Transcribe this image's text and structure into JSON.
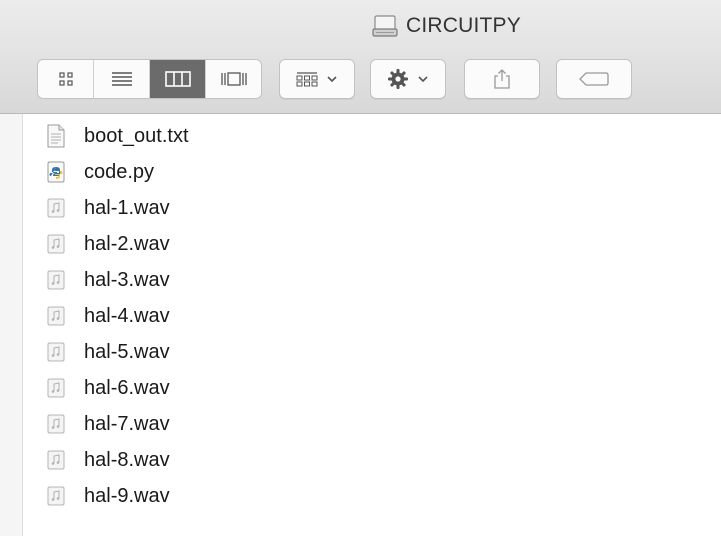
{
  "window": {
    "title": "CIRCUITPY",
    "title_icon": "drive-icon"
  },
  "toolbar": {
    "view_modes": [
      {
        "name": "icon-view",
        "icon": "grid-icon",
        "active": false
      },
      {
        "name": "list-view",
        "icon": "list-icon",
        "active": false
      },
      {
        "name": "column-view",
        "icon": "columns-icon",
        "active": true
      },
      {
        "name": "cover-flow-view",
        "icon": "cover-flow-icon",
        "active": false
      }
    ],
    "arrange_icon": "arrange-icon",
    "action_icon": "gear-icon",
    "share_icon": "share-icon",
    "tag_icon": "tag-icon"
  },
  "files": [
    {
      "name": "boot_out.txt",
      "icon": "text-file-icon"
    },
    {
      "name": "code.py",
      "icon": "python-file-icon"
    },
    {
      "name": "hal-1.wav",
      "icon": "audio-file-icon"
    },
    {
      "name": "hal-2.wav",
      "icon": "audio-file-icon"
    },
    {
      "name": "hal-3.wav",
      "icon": "audio-file-icon"
    },
    {
      "name": "hal-4.wav",
      "icon": "audio-file-icon"
    },
    {
      "name": "hal-5.wav",
      "icon": "audio-file-icon"
    },
    {
      "name": "hal-6.wav",
      "icon": "audio-file-icon"
    },
    {
      "name": "hal-7.wav",
      "icon": "audio-file-icon"
    },
    {
      "name": "hal-8.wav",
      "icon": "audio-file-icon"
    },
    {
      "name": "hal-9.wav",
      "icon": "audio-file-icon"
    }
  ],
  "colors": {
    "active_segment": "#6b6b6b",
    "toolbar_bg": "#e3e3e3"
  }
}
